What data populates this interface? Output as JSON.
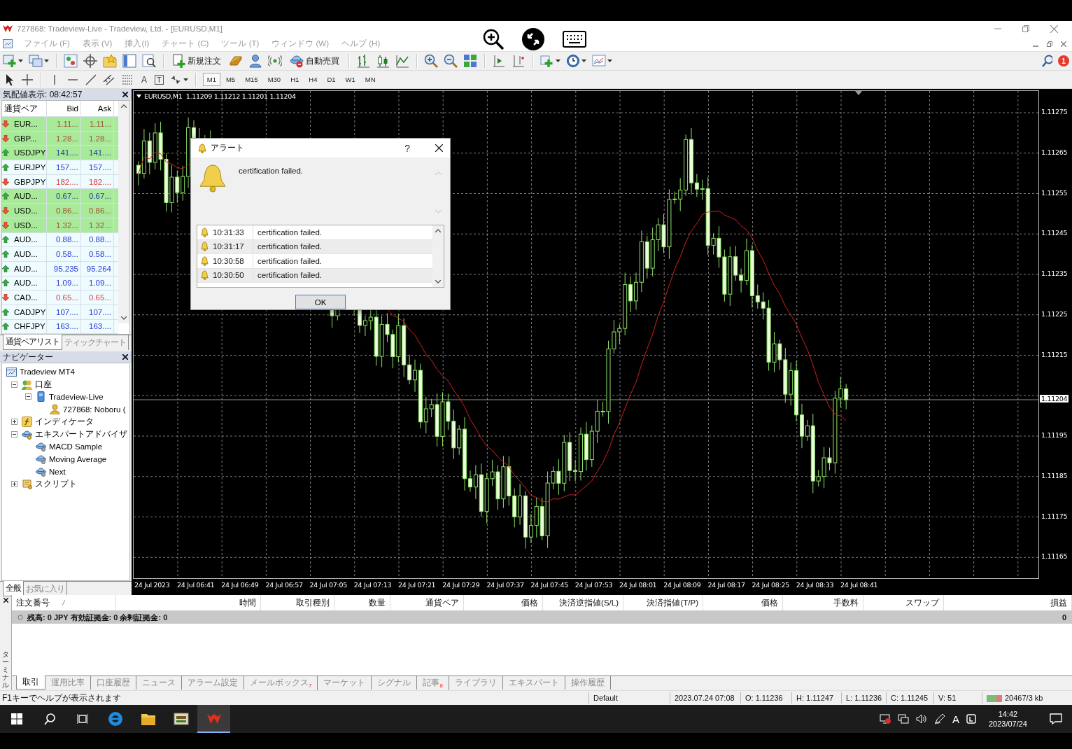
{
  "window": {
    "title": "727868: Tradeview-Live - Tradeview, Ltd. - [EURUSD,M1]"
  },
  "menu": [
    {
      "label": "ファイル (F)",
      "disabled": true
    },
    {
      "label": "表示 (V)",
      "disabled": true
    },
    {
      "label": "挿入(I)",
      "disabled": true
    },
    {
      "label": "チャート (C)",
      "disabled": true
    },
    {
      "label": "ツール (T)",
      "disabled": true
    },
    {
      "label": "ウィンドウ (W)",
      "disabled": true
    },
    {
      "label": "ヘルプ (H)",
      "disabled": true
    }
  ],
  "toolbar": {
    "new_order": "新規注文",
    "auto_trading": "自動売買",
    "notification_badge": "1"
  },
  "drawing_toolbar": {
    "text_tool": "A",
    "text_label_tool": "T"
  },
  "timeframes": [
    {
      "label": "M1",
      "selected": true
    },
    {
      "label": "M5",
      "selected": false
    },
    {
      "label": "M15",
      "selected": false
    },
    {
      "label": "M30",
      "selected": false
    },
    {
      "label": "H1",
      "selected": false
    },
    {
      "label": "H4",
      "selected": false
    },
    {
      "label": "D1",
      "selected": false
    },
    {
      "label": "W1",
      "selected": false
    },
    {
      "label": "MN",
      "selected": false
    }
  ],
  "market_watch": {
    "title": "気配値表示: 08:42:57",
    "columns": [
      "通貨ペア",
      "Bid",
      "Ask"
    ],
    "rows": [
      {
        "symbol": "EUR...",
        "bid": "1.11...",
        "ask": "1.11...",
        "rising": false,
        "highlighted": true
      },
      {
        "symbol": "GBP...",
        "bid": "1.28...",
        "ask": "1.28...",
        "rising": false,
        "highlighted": true
      },
      {
        "symbol": "USDJPY",
        "bid": "141....",
        "ask": "141....",
        "rising": true,
        "highlighted": true
      },
      {
        "symbol": "EURJPY",
        "bid": "157....",
        "ask": "157....",
        "rising": true,
        "highlighted": false
      },
      {
        "symbol": "GBPJPY",
        "bid": "182....",
        "ask": "182....",
        "rising": false,
        "highlighted": false
      },
      {
        "symbol": "AUD...",
        "bid": "0.67...",
        "ask": "0.67...",
        "rising": true,
        "highlighted": true
      },
      {
        "symbol": "USD...",
        "bid": "0.86...",
        "ask": "0.86...",
        "rising": false,
        "highlighted": true
      },
      {
        "symbol": "USD...",
        "bid": "1.32...",
        "ask": "1.32...",
        "rising": false,
        "highlighted": true
      },
      {
        "symbol": "AUD...",
        "bid": "0.88...",
        "ask": "0.88...",
        "rising": true,
        "highlighted": false
      },
      {
        "symbol": "AUD...",
        "bid": "0.58...",
        "ask": "0.58...",
        "rising": true,
        "highlighted": false
      },
      {
        "symbol": "AUD...",
        "bid": "95.235",
        "ask": "95.264",
        "rising": true,
        "highlighted": false
      },
      {
        "symbol": "AUD...",
        "bid": "1.09...",
        "ask": "1.09...",
        "rising": true,
        "highlighted": false
      },
      {
        "symbol": "CAD...",
        "bid": "0.65...",
        "ask": "0.65...",
        "rising": false,
        "highlighted": false
      },
      {
        "symbol": "CADJPY",
        "bid": "107....",
        "ask": "107....",
        "rising": true,
        "highlighted": false
      },
      {
        "symbol": "CHFJPY",
        "bid": "163....",
        "ask": "163....",
        "rising": true,
        "highlighted": false
      }
    ],
    "tabs": [
      {
        "label": "通貨ペアリスト",
        "selected": true
      },
      {
        "label": "ティックチャート",
        "selected": false
      }
    ]
  },
  "navigator": {
    "title": "ナビゲーター",
    "tree": [
      {
        "label": "Tradeview MT4",
        "kind": "terminal",
        "children": [
          {
            "label": "口座",
            "kind": "accounts",
            "expanded": true,
            "children": [
              {
                "label": "Tradeview-Live",
                "kind": "server",
                "expanded": true,
                "children": [
                  {
                    "label": "727868: Noboru (",
                    "kind": "account"
                  }
                ]
              }
            ]
          },
          {
            "label": "インディケータ",
            "kind": "indicators",
            "expanded": false
          },
          {
            "label": "エキスパートアドバイザ",
            "kind": "experts",
            "expanded": true,
            "children": [
              {
                "label": "MACD Sample",
                "kind": "expert"
              },
              {
                "label": "Moving Average",
                "kind": "expert"
              },
              {
                "label": "Next",
                "kind": "expert"
              }
            ]
          },
          {
            "label": "スクリプト",
            "kind": "scripts",
            "expanded": false
          }
        ]
      }
    ],
    "tabs": [
      {
        "label": "全般",
        "selected": true
      },
      {
        "label": "お気に入り",
        "selected": false
      }
    ]
  },
  "chart": {
    "header": "EURUSD,M1  1.11209 1.11212 1.11201 1.11204",
    "price_labels": [
      "1.11275",
      "1.11265",
      "1.11255",
      "1.11245",
      "1.11235",
      "1.11225",
      "1.11215",
      "1.11195",
      "1.11185",
      "1.11175",
      "1.11165"
    ],
    "current_price": "1.11204",
    "time_labels": [
      "24 Jul 2023",
      "24 Jul 06:41",
      "24 Jul 06:49",
      "24 Jul 06:57",
      "24 Jul 07:05",
      "24 Jul 07:13",
      "24 Jul 07:21",
      "24 Jul 07:29",
      "24 Jul 07:37",
      "24 Jul 07:45",
      "24 Jul 07:53",
      "24 Jul 08:01",
      "24 Jul 08:09",
      "24 Jul 08:17",
      "24 Jul 08:25",
      "24 Jul 08:33",
      "24 Jul 08:41"
    ]
  },
  "alert_dialog": {
    "title": "アラート",
    "help": "?",
    "message": "certification failed.",
    "log": [
      {
        "time": "10:31:33",
        "message": "certification failed."
      },
      {
        "time": "10:31:17",
        "message": "certification failed."
      },
      {
        "time": "10:30:58",
        "message": "certification failed."
      },
      {
        "time": "10:30:50",
        "message": "certification failed."
      }
    ],
    "ok": "OK"
  },
  "terminal": {
    "label": "ターミナル",
    "columns": [
      "注文番号",
      "時間",
      "取引種別",
      "数量",
      "通貨ペア",
      "価格",
      "決済逆指値(S/L)",
      "決済指値(T/P)",
      "価格",
      "手数料",
      "スワップ",
      "損益"
    ],
    "balance": "残高: 0 JPY  有効証拠金: 0  余剰証拠金: 0",
    "profit": "0",
    "tabs": [
      {
        "label": "取引",
        "selected": true
      },
      {
        "label": "運用比率",
        "selected": false
      },
      {
        "label": "口座履歴",
        "selected": false
      },
      {
        "label": "ニュース",
        "selected": false
      },
      {
        "label": "アラーム設定",
        "selected": false
      },
      {
        "label": "メールボックス",
        "selected": false,
        "badge": "7"
      },
      {
        "label": "マーケット",
        "selected": false
      },
      {
        "label": "シグナル",
        "selected": false
      },
      {
        "label": "記事",
        "selected": false,
        "badge": "8"
      },
      {
        "label": "ライブラリ",
        "selected": false
      },
      {
        "label": "エキスパート",
        "selected": false
      },
      {
        "label": "操作履歴",
        "selected": false
      }
    ]
  },
  "status_bar": {
    "help": "F1キーでヘルプが表示されます",
    "profile": "Default",
    "datetime": "2023.07.24 07:08",
    "open": "O: 1.11236",
    "high": "H: 1.11247",
    "low": "L: 1.11236",
    "close": "C: 1.11245",
    "volume": "V: 51",
    "traffic": "20467/3 kb"
  },
  "taskbar": {
    "apps": [
      {
        "kind": "browser",
        "selected": false
      },
      {
        "kind": "folder",
        "selected": false
      },
      {
        "kind": "app",
        "selected": false
      },
      {
        "kind": "trader",
        "selected": true
      }
    ],
    "ime": "A",
    "time": "14:42",
    "date": "2023/07/24"
  }
}
